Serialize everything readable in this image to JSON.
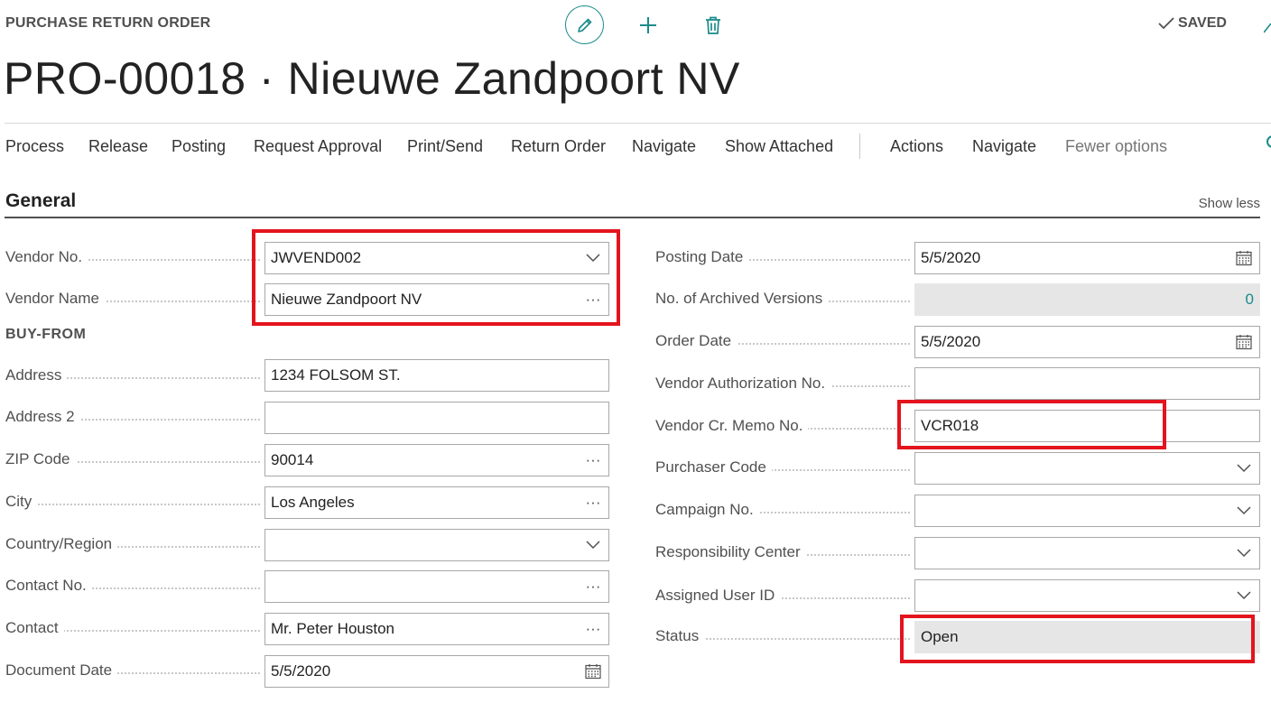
{
  "header": {
    "caption": "PURCHASE RETURN ORDER",
    "title": "PRO-00018 · Nieuwe Zandpoort NV",
    "saved_label": "SAVED",
    "icons": [
      "edit-icon",
      "add-icon",
      "delete-icon",
      "checkmark-icon",
      "expand-icon"
    ]
  },
  "action_bar": {
    "items": [
      "Process",
      "Release",
      "Posting",
      "Request Approval",
      "Print/Send",
      "Return Order",
      "Navigate",
      "Show Attached"
    ],
    "secondary": [
      "Actions",
      "Navigate"
    ],
    "fewer_options": "Fewer options"
  },
  "general": {
    "title": "General",
    "show_less": "Show less",
    "buy_from_heading": "BUY-FROM",
    "left_fields": [
      {
        "label": "Vendor No.",
        "value": "JWVEND002",
        "control": "dropdown"
      },
      {
        "label": "Vendor Name",
        "value": "Nieuwe Zandpoort NV",
        "control": "lookup"
      },
      {
        "label": "Address",
        "value": "1234 FOLSOM ST.",
        "control": "text"
      },
      {
        "label": "Address 2",
        "value": "",
        "control": "text"
      },
      {
        "label": "ZIP Code",
        "value": "90014",
        "control": "lookup"
      },
      {
        "label": "City",
        "value": "Los Angeles",
        "control": "lookup"
      },
      {
        "label": "Country/Region",
        "value": "",
        "control": "dropdown"
      },
      {
        "label": "Contact No.",
        "value": "",
        "control": "lookup"
      },
      {
        "label": "Contact",
        "value": "Mr. Peter Houston",
        "control": "lookup"
      },
      {
        "label": "Document Date",
        "value": "5/5/2020",
        "control": "date"
      }
    ],
    "right_fields": [
      {
        "label": "Posting Date",
        "value": "5/5/2020",
        "control": "date"
      },
      {
        "label": "No. of Archived Versions",
        "value": "0",
        "control": "readonly"
      },
      {
        "label": "Order Date",
        "value": "5/5/2020",
        "control": "date"
      },
      {
        "label": "Vendor Authorization No.",
        "value": "",
        "control": "text"
      },
      {
        "label": "Vendor Cr. Memo No.",
        "value": "VCR018",
        "control": "text"
      },
      {
        "label": "Purchaser Code",
        "value": "",
        "control": "dropdown"
      },
      {
        "label": "Campaign No.",
        "value": "",
        "control": "dropdown"
      },
      {
        "label": "Responsibility Center",
        "value": "",
        "control": "dropdown"
      },
      {
        "label": "Assigned User ID",
        "value": "",
        "control": "dropdown"
      },
      {
        "label": "Status",
        "value": "Open",
        "control": "readonly"
      }
    ]
  },
  "colors": {
    "accent": "#1a8a8a",
    "highlight": "#e3141e",
    "readonly_bg": "#e6e6e6"
  }
}
